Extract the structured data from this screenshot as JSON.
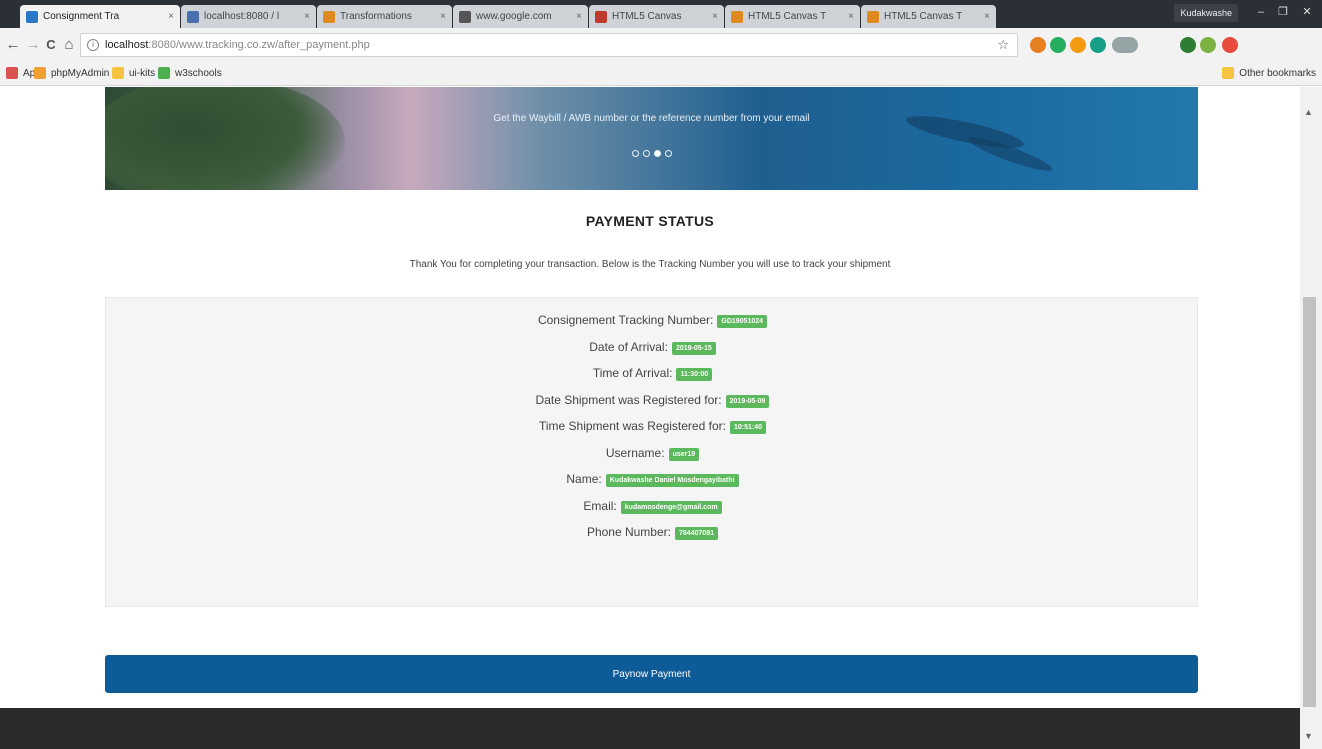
{
  "browser": {
    "tabs": [
      {
        "label": "Consignment Tra",
        "active": true,
        "color": "#2b78c9"
      },
      {
        "label": "localhost:8080 / l",
        "active": false,
        "color": "#4a6fb0"
      },
      {
        "label": "Transformations",
        "active": false,
        "color": "#e08a1e"
      },
      {
        "label": "www.google.com",
        "active": false,
        "color": "#555555"
      },
      {
        "label": "HTML5 Canvas",
        "active": false,
        "color": "#c0392b"
      },
      {
        "label": "HTML5 Canvas T",
        "active": false,
        "color": "#e08a1e"
      },
      {
        "label": "HTML5 Canvas T",
        "active": false,
        "color": "#e08a1e"
      }
    ],
    "tab_close": "×",
    "window_user": "Kudakwashe",
    "window_controls": [
      "–",
      "❐",
      "✕"
    ],
    "nav": {
      "back": "←",
      "forward": "→",
      "reload": "C",
      "home": "⌂"
    },
    "address": {
      "host": "localhost",
      "path": ":8080/www.tracking.co.zw/after_payment.php",
      "info": "i",
      "star": "☆"
    },
    "bookmarks": [
      {
        "label": "Apps",
        "color": "#d9534f"
      },
      {
        "label": "phpMyAdmin",
        "color": "#f0a030"
      },
      {
        "label": "ui-kits",
        "color": "#f5c542"
      },
      {
        "label": "w3schools",
        "color": "#4caf50"
      }
    ],
    "other_bookmarks": "Other bookmarks",
    "extension_colors": [
      "#e67e22",
      "#27ae60",
      "#f39c12",
      "#16a085",
      "#95a5a6",
      "#2e7d32",
      "#7cb342",
      "#e74c3c"
    ]
  },
  "hero": {
    "caption": "Get the Waybill / AWB number or the reference number from your email",
    "slide_count": 4,
    "active_slide": 3
  },
  "status": {
    "title": "PAYMENT STATUS",
    "thanks": "Thank You for completing your transaction. Below is the Tracking Number you will use to track your shipment"
  },
  "details": [
    {
      "label": "Consignement Tracking Number",
      "value": "GD19051024"
    },
    {
      "label": "Date of Arrival",
      "value": "2019-05-15"
    },
    {
      "label": "Time of Arrival",
      "value": "11:30:00"
    },
    {
      "label": "Date Shipment was Registered for",
      "value": "2019-05-09"
    },
    {
      "label": "Time Shipment was Registered for",
      "value": "10:51:40"
    },
    {
      "label": "Username",
      "value": "user19"
    },
    {
      "label": "Name",
      "value": "Kudakwashe Daniel Mosdengayibathi"
    },
    {
      "label": "Email",
      "value": "kudamosdenge@gmail.com"
    },
    {
      "label": "Phone Number",
      "value": "784407091"
    }
  ],
  "pay_button": "Paynow Payment",
  "colors": {
    "accent": "#0d5b97",
    "badge": "#5cb85c",
    "footer": "#2b2b2b"
  }
}
